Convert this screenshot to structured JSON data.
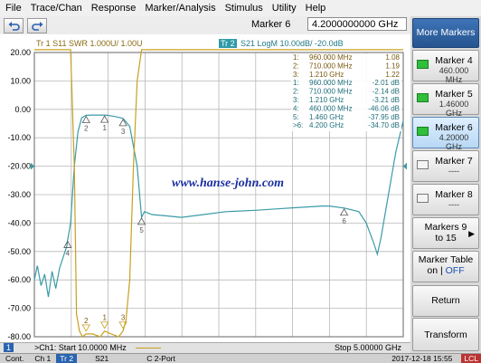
{
  "menu": [
    "File",
    "Trace/Chan",
    "Response",
    "Marker/Analysis",
    "Stimulus",
    "Utility",
    "Help"
  ],
  "toolbar": {
    "undo_icon": "undo-arrow-icon",
    "redo_icon": "redo-arrow-icon",
    "marker_label": "Marker 6",
    "marker_stimulus": "4.2000000000 GHz"
  },
  "colors": {
    "trace1": "#c8a020",
    "trace2": "#3a9ba8",
    "grid": "#b8b8b8",
    "watermark": "#1a2fa0",
    "softkey_title": "#2f5e9c",
    "indicator_on": "#2fbf3a"
  },
  "softkeys": {
    "title": "More Markers",
    "items": [
      {
        "label": "Marker 4",
        "sub": "460.000 MHz",
        "on": true,
        "active": false
      },
      {
        "label": "Marker 5",
        "sub": "1.46000 GHz",
        "on": true,
        "active": false
      },
      {
        "label": "Marker 6",
        "sub": "4.20000 GHz",
        "on": true,
        "active": true
      },
      {
        "label": "Marker 7",
        "sub": "----",
        "on": false,
        "active": false
      },
      {
        "label": "Marker 8",
        "sub": "----",
        "on": false,
        "active": false
      }
    ],
    "markers_9_15": "Markers 9\nto 15",
    "marker_table_label": "Marker Table",
    "marker_table_on": "on",
    "marker_table_sep": " | ",
    "marker_table_off": "OFF",
    "return": "Return",
    "transform": "Transform"
  },
  "trace_header": {
    "tr1": "Tr 1  S11 SWR 1.000U/ 1.00U",
    "tr2_badge": "Tr 2",
    "tr2": "S21 LogM 10.00dB/ -20.0dB"
  },
  "marker_table": [
    {
      "n": "1:",
      "f": "960.000 MHz",
      "v": "1.08"
    },
    {
      "n": "2:",
      "f": "710.000 MHz",
      "v": "1.19"
    },
    {
      "n": "3:",
      "f": "1.210 GHz",
      "v": "1.22"
    },
    {
      "n": "1:",
      "f": "960.000 MHz",
      "v": "-2.01 dB"
    },
    {
      "n": "2:",
      "f": "710.000 MHz",
      "v": "-2.14 dB"
    },
    {
      "n": "3:",
      "f": "1.210 GHz",
      "v": "-3.21 dB"
    },
    {
      "n": "4:",
      "f": "460.000 MHz",
      "v": "-46.06 dB"
    },
    {
      "n": "5:",
      "f": "1.460 GHz",
      "v": "-37.95 dB"
    },
    {
      "n": ">6:",
      "f": "4.200 GHz",
      "v": "-34.70 dB"
    }
  ],
  "chart_data": {
    "type": "line",
    "ylim": [
      -80,
      20
    ],
    "yticks": [
      "20.00",
      "10.00",
      "0.00",
      "-10.00",
      "-20.00",
      "-30.00",
      "-40.00",
      "-50.00",
      "-60.00",
      "-70.00",
      "-80.00"
    ],
    "x_start_label": ">Ch1:  Start  10.0000 MHz",
    "x_stop_label": "Stop  5.00000 GHz",
    "x_range_ghz": [
      0.01,
      5.0
    ],
    "series": [
      {
        "name": "S21",
        "x": [
          0.01,
          0.05,
          0.1,
          0.15,
          0.2,
          0.25,
          0.3,
          0.35,
          0.4,
          0.45,
          0.46,
          0.5,
          0.55,
          0.6,
          0.65,
          0.71,
          0.8,
          0.9,
          0.96,
          1.0,
          1.1,
          1.21,
          1.3,
          1.4,
          1.46,
          1.5,
          1.6,
          1.8,
          2.0,
          2.3,
          2.6,
          3.0,
          3.3,
          3.6,
          3.9,
          4.0,
          4.2,
          4.4,
          4.5,
          4.6,
          4.65,
          4.7,
          4.8,
          4.9,
          5.0
        ],
        "y": [
          -60,
          -55,
          -62,
          -58,
          -66,
          -57,
          -63,
          -56,
          -52,
          -48,
          -46,
          -40,
          -20,
          -8,
          -3,
          -2.1,
          -2,
          -2,
          -2,
          -2.1,
          -2.5,
          -3.2,
          -6,
          -20,
          -38,
          -36,
          -37,
          -37.5,
          -38,
          -37,
          -36,
          -35.5,
          -35,
          -34.5,
          -34,
          -34,
          -34.7,
          -36,
          -40,
          -47,
          -51,
          -45,
          -30,
          -15,
          -4
        ]
      },
      {
        "name": "S11",
        "x": [
          0.01,
          0.5,
          0.55,
          0.58,
          0.62,
          0.66,
          0.71,
          0.8,
          0.9,
          0.96,
          1.05,
          1.15,
          1.21,
          1.25,
          1.3,
          1.35,
          1.4,
          1.46,
          1.5,
          5.0
        ],
        "y": [
          21,
          21,
          -20,
          -72,
          -78,
          -80,
          -79,
          -79,
          -80,
          -78,
          -79,
          -80,
          -78,
          -74,
          -60,
          -20,
          10,
          21,
          21,
          21
        ]
      }
    ],
    "markers": [
      {
        "label": "1",
        "x": 0.96,
        "y": -2.01
      },
      {
        "label": "2",
        "x": 0.71,
        "y": -2.14
      },
      {
        "label": "3",
        "x": 1.21,
        "y": -3.21
      },
      {
        "label": "4",
        "x": 0.46,
        "y": -46.06
      },
      {
        "label": "5",
        "x": 1.46,
        "y": -37.95
      },
      {
        "label": "6",
        "x": 4.2,
        "y": -34.7
      }
    ],
    "s11_markers": [
      {
        "label": "2",
        "x": 0.71,
        "y": -79
      },
      {
        "label": "1",
        "x": 0.96,
        "y": -78
      },
      {
        "label": "3",
        "x": 1.21,
        "y": -78
      }
    ],
    "watermark": "www.hanse-john.com"
  },
  "statusbar": {
    "chan": "1"
  },
  "bottombar": {
    "cont": "Cont.",
    "ch": "Ch 1",
    "tr": "Tr 2",
    "param": "S21",
    "port": "C  2-Port",
    "datetime": "2017-12-18  15:55",
    "lcl": "LCL"
  }
}
